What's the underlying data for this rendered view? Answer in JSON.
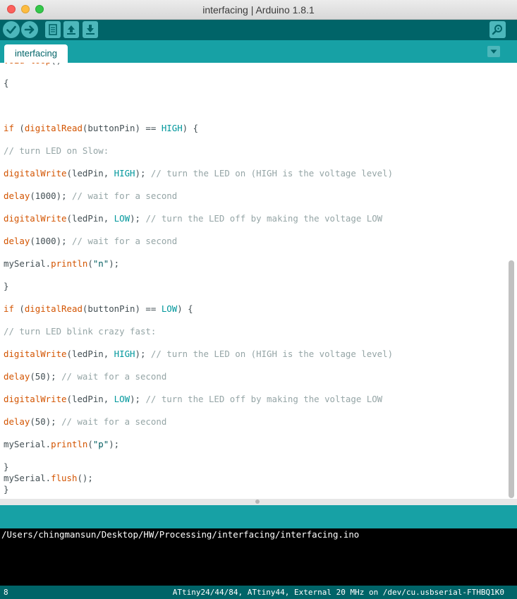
{
  "window": {
    "title": "interfacing | Arduino 1.8.1"
  },
  "toolbar": {
    "buttons": [
      {
        "name": "verify",
        "icon": "checkmark-icon"
      },
      {
        "name": "upload",
        "icon": "arrow-right-icon"
      },
      {
        "name": "new",
        "icon": "new-file-icon"
      },
      {
        "name": "open",
        "icon": "arrow-up-icon"
      },
      {
        "name": "save",
        "icon": "arrow-down-icon"
      },
      {
        "name": "serial-monitor",
        "icon": "magnifier-icon"
      }
    ]
  },
  "tabs": {
    "active": "interfacing"
  },
  "editor": {
    "lines": [
      "void loop()",
      "{",
      "",
      "if (digitalRead(buttonPin) == HIGH) {",
      "// turn LED on Slow:",
      "digitalWrite(ledPin, HIGH); // turn the LED on (HIGH is the voltage level)",
      "delay(1000); // wait for a second",
      "digitalWrite(ledPin, LOW); // turn the LED off by making the voltage LOW",
      "delay(1000); // wait for a second",
      "mySerial.println(\"n\");",
      "}",
      "if (digitalRead(buttonPin) == LOW) {",
      "// turn LED blink crazy fast:",
      "digitalWrite(ledPin, HIGH); // turn the LED on (HIGH is the voltage level)",
      "delay(50); // wait for a second",
      "digitalWrite(ledPin, LOW); // turn the LED off by making the voltage LOW",
      "delay(50); // wait for a second",
      "mySerial.println(\"p\");",
      "}",
      "mySerial.flush();",
      "}"
    ]
  },
  "console": {
    "text": "/Users/chingmansun/Desktop/HW/Processing/interfacing/interfacing.ino"
  },
  "status": {
    "line_number": "8",
    "board": "ATtiny24/44/84, ATtiny44, External 20 MHz on /dev/cu.usbserial-FTHBQ1K0"
  },
  "colors": {
    "toolbar": "#006468",
    "tabbar": "#17a1a5",
    "button": "#4db7bb",
    "keyword": "#d35400",
    "constant": "#00979c",
    "comment": "#95a5a6"
  }
}
